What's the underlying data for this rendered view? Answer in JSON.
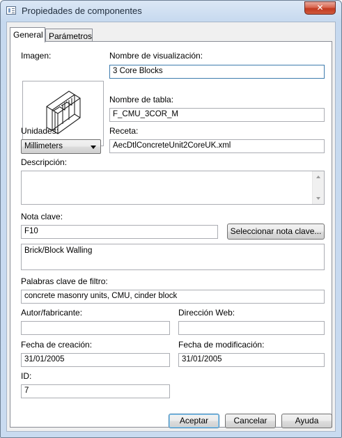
{
  "window": {
    "title": "Propiedades de componentes",
    "close_label": "✕"
  },
  "tabs": [
    {
      "label": "General"
    },
    {
      "label": "Parámetros"
    }
  ],
  "general": {
    "image_label": "Imagen:",
    "display_name": {
      "label": "Nombre de visualización:",
      "value": "3 Core Blocks"
    },
    "table_name": {
      "label": "Nombre de tabla:",
      "value": "F_CMU_3COR_M"
    },
    "units": {
      "label": "Unidades:",
      "value": "Millimeters"
    },
    "recipe": {
      "label": "Receta:",
      "value": "AecDtlConcreteUnit2CoreUK.xml"
    },
    "description": {
      "label": "Descripción:",
      "value": ""
    },
    "keynote": {
      "label": "Nota clave:",
      "value": "F10",
      "button": "Seleccionar nota clave...",
      "description": "Brick/Block Walling"
    },
    "filter_keywords": {
      "label": "Palabras clave de filtro:",
      "value": "concrete masonry units, CMU, cinder block"
    },
    "author": {
      "label": "Autor/fabricante:",
      "value": ""
    },
    "web_address": {
      "label": "Dirección Web:",
      "value": ""
    },
    "created": {
      "label": "Fecha de creación:",
      "value": "31/01/2005"
    },
    "modified": {
      "label": "Fecha de modificación:",
      "value": "31/01/2005"
    },
    "id": {
      "label": "ID:",
      "value": "7"
    }
  },
  "buttons": {
    "ok": "Aceptar",
    "cancel": "Cancelar",
    "help": "Ayuda"
  }
}
